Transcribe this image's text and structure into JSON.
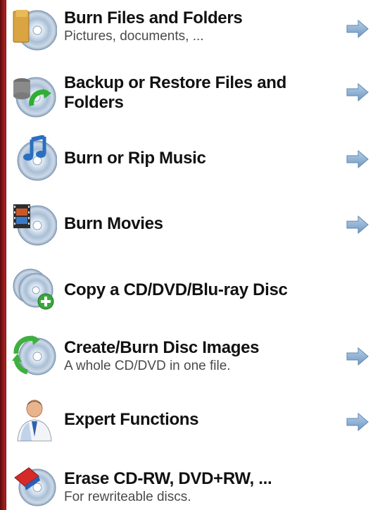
{
  "menu": {
    "items": [
      {
        "title": "Burn Files and Folders",
        "subtitle": "Pictures, documents, ...",
        "icon": "folder-disc-icon",
        "arrow": "arrow-right-icon"
      },
      {
        "title": "Backup or Restore Files and Folders",
        "subtitle": "",
        "icon": "backup-restore-disc-icon",
        "arrow": "arrow-right-icon"
      },
      {
        "title": "Burn or Rip Music",
        "subtitle": "",
        "icon": "music-disc-icon",
        "arrow": "arrow-right-icon"
      },
      {
        "title": "Burn Movies",
        "subtitle": "",
        "icon": "film-disc-icon",
        "arrow": "arrow-right-icon"
      },
      {
        "title": "Copy a CD/DVD/Blu-ray Disc",
        "subtitle": "",
        "icon": "copy-disc-icon",
        "arrow": ""
      },
      {
        "title": "Create/Burn Disc Images",
        "subtitle": "A whole CD/DVD in one file.",
        "icon": "disc-image-icon",
        "arrow": "arrow-right-icon"
      },
      {
        "title": "Expert Functions",
        "subtitle": "",
        "icon": "expert-person-icon",
        "arrow": "arrow-right-icon"
      },
      {
        "title": "Erase CD-RW, DVD+RW, ...",
        "subtitle": "For rewriteable discs.",
        "icon": "eraser-disc-icon",
        "arrow": ""
      }
    ]
  },
  "colors": {
    "left_border": "#8d1818",
    "title_text": "#111111",
    "subtitle_text": "#4a4a4a",
    "arrow": "#8fb4d6"
  }
}
